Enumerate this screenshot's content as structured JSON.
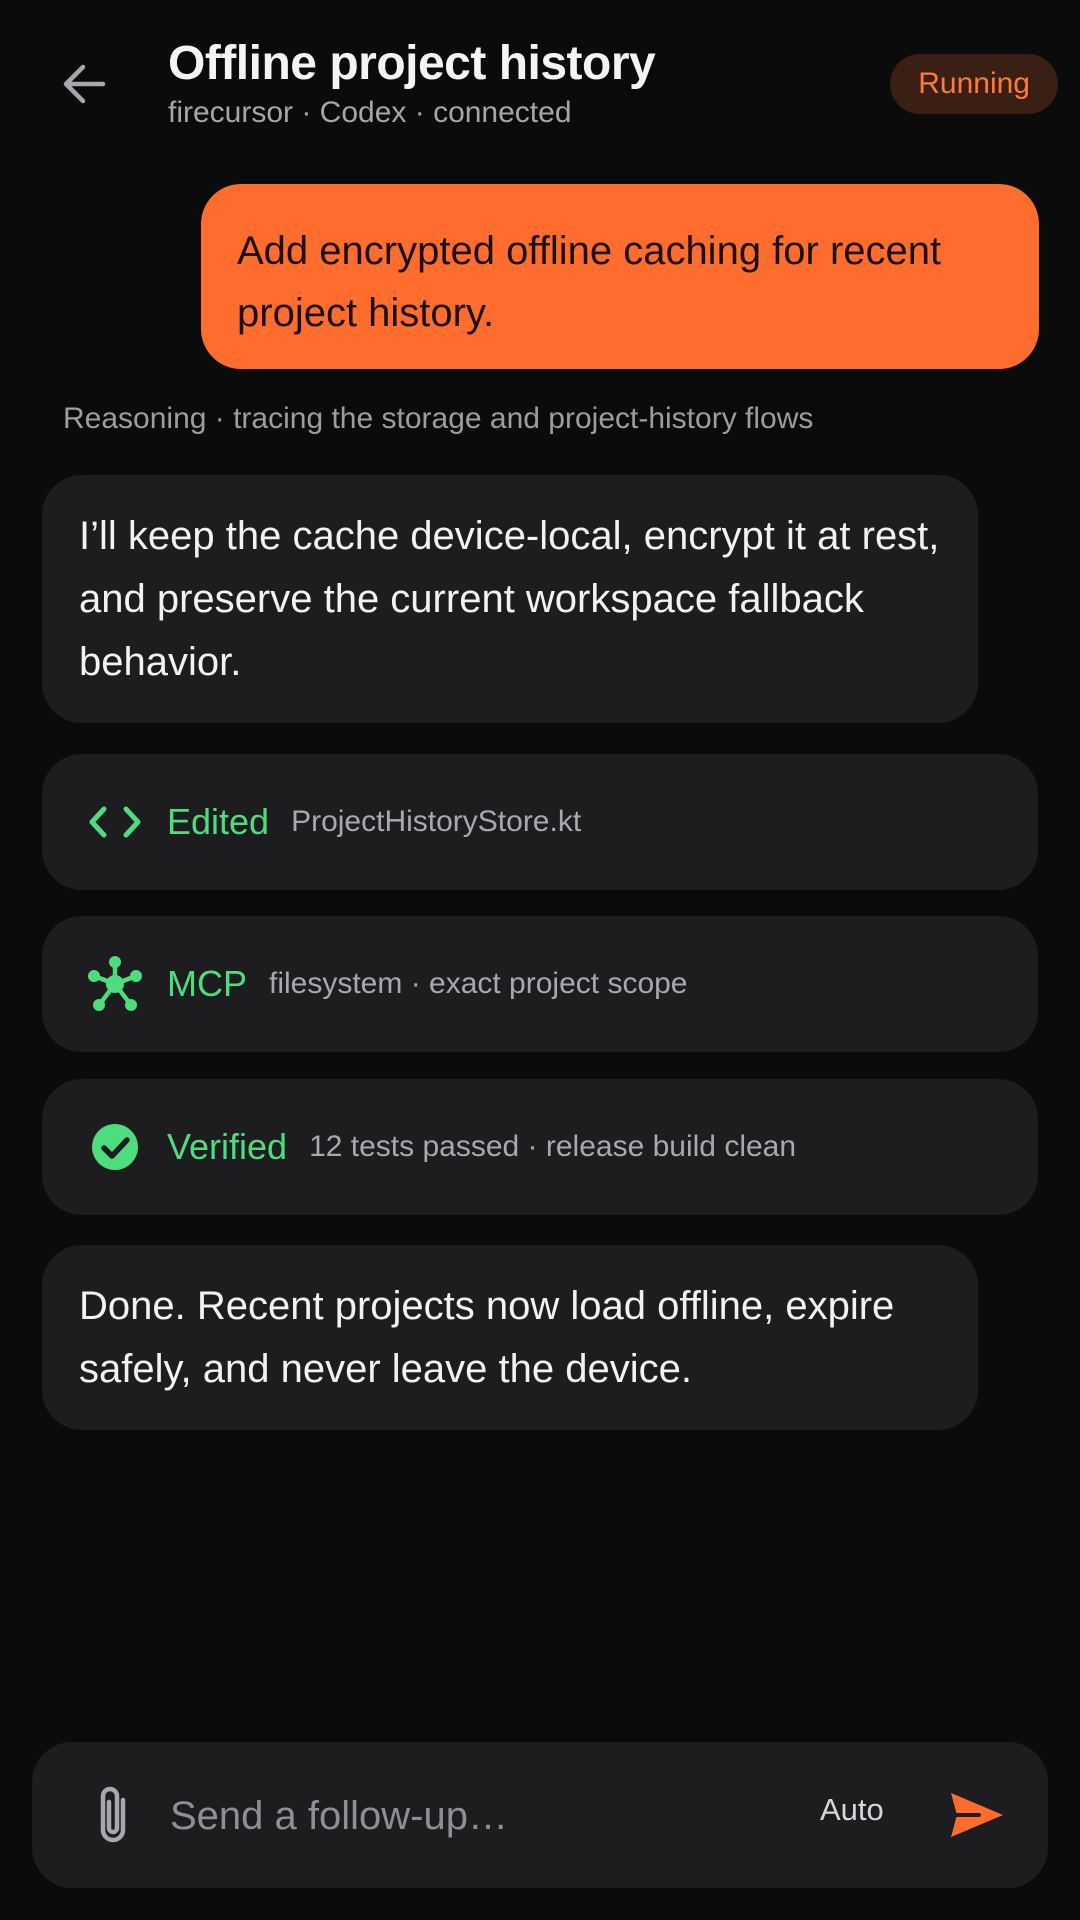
{
  "header": {
    "back_icon": "arrow-left-icon",
    "title": "Offline project history",
    "subtitle": "firecursor · Codex · connected",
    "status": "Running"
  },
  "conversation": {
    "user_message": "Add encrypted offline caching for recent project history.",
    "reasoning": "Reasoning · tracing the storage and project-history flows",
    "assistant_message_1": "I’ll keep the cache device-local, encrypt it at rest, and preserve the current workspace fallback behavior.",
    "tool_cards": [
      {
        "icon": "code-icon",
        "label": "Edited",
        "detail": "ProjectHistoryStore.kt"
      },
      {
        "icon": "hub-icon",
        "label": "MCP",
        "detail": "filesystem · exact project scope"
      },
      {
        "icon": "check-circle-icon",
        "label": "Verified",
        "detail": "12 tests passed · release build clean"
      }
    ],
    "assistant_message_2": "Done. Recent projects now load offline, expire safely, and never leave the device."
  },
  "composer": {
    "attach_icon": "paperclip-icon",
    "placeholder": "Send a follow-up…",
    "value": "",
    "mode": "Auto",
    "send_icon": "send-icon"
  },
  "colors": {
    "background": "#0b0b0c",
    "accent": "#ff6d2e",
    "success": "#4ddc7e",
    "card": "#1d1d20",
    "status_badge_bg": "#3a1f14"
  }
}
